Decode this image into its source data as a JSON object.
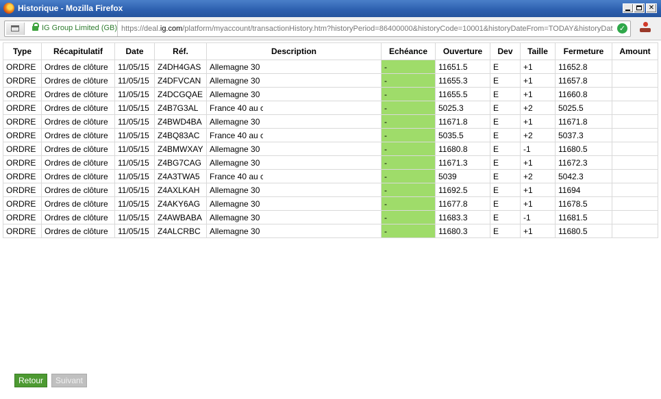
{
  "window": {
    "title": "Historique - Mozilla Firefox",
    "controls": {
      "minimize": "_",
      "maximize": "□",
      "close": "✕"
    }
  },
  "urlbar": {
    "identity": "IG Group Limited (GB)",
    "url_prefix": "https://deal.",
    "url_host": "ig.com",
    "url_rest": "/platform/myaccount/transactionHistory.htm?historyPeriod=86400000&historyCode=10001&historyDateFrom=TODAY&historyDat",
    "check_glyph": "✓"
  },
  "table": {
    "headers": [
      "Type",
      "Récapitulatif",
      "Date",
      "Réf.",
      "Description",
      "Echéance",
      "Ouverture",
      "Dev",
      "Taille",
      "Fermeture",
      "Amount"
    ],
    "rows": [
      {
        "type": "ORDRE",
        "recap": "Ordres de clôture",
        "date": "11/05/15",
        "ref": "Z4DH4GAS",
        "desc": "Allemagne 30",
        "ech": "-",
        "ouv": "11651.5",
        "dev": "E",
        "taille": "+1",
        "ferm": "11652.8"
      },
      {
        "type": "ORDRE",
        "recap": "Ordres de clôture",
        "date": "11/05/15",
        "ref": "Z4DFVCAN",
        "desc": "Allemagne 30",
        "ech": "-",
        "ouv": "11655.3",
        "dev": "E",
        "taille": "+1",
        "ferm": "11657.8"
      },
      {
        "type": "ORDRE",
        "recap": "Ordres de clôture",
        "date": "11/05/15",
        "ref": "Z4DCGQAE",
        "desc": "Allemagne 30",
        "ech": "-",
        "ouv": "11655.5",
        "dev": "E",
        "taille": "+1",
        "ferm": "11660.8"
      },
      {
        "type": "ORDRE",
        "recap": "Ordres de clôture",
        "date": "11/05/15",
        "ref": "Z4B7G3AL",
        "desc": "France 40 au c",
        "ech": "-",
        "ouv": "5025.3",
        "dev": "E",
        "taille": "+2",
        "ferm": "5025.5"
      },
      {
        "type": "ORDRE",
        "recap": "Ordres de clôture",
        "date": "11/05/15",
        "ref": "Z4BWD4BA",
        "desc": "Allemagne 30",
        "ech": "-",
        "ouv": "11671.8",
        "dev": "E",
        "taille": "+1",
        "ferm": "11671.8"
      },
      {
        "type": "ORDRE",
        "recap": "Ordres de clôture",
        "date": "11/05/15",
        "ref": "Z4BQ83AC",
        "desc": "France 40 au c",
        "ech": "-",
        "ouv": "5035.5",
        "dev": "E",
        "taille": "+2",
        "ferm": "5037.3"
      },
      {
        "type": "ORDRE",
        "recap": "Ordres de clôture",
        "date": "11/05/15",
        "ref": "Z4BMWXAY",
        "desc": "Allemagne 30",
        "ech": "-",
        "ouv": "11680.8",
        "dev": "E",
        "taille": "-1",
        "ferm": "11680.5"
      },
      {
        "type": "ORDRE",
        "recap": "Ordres de clôture",
        "date": "11/05/15",
        "ref": "Z4BG7CAG",
        "desc": "Allemagne 30",
        "ech": "-",
        "ouv": "11671.3",
        "dev": "E",
        "taille": "+1",
        "ferm": "11672.3"
      },
      {
        "type": "ORDRE",
        "recap": "Ordres de clôture",
        "date": "11/05/15",
        "ref": "Z4A3TWA5",
        "desc": "France 40 au c",
        "ech": "-",
        "ouv": "5039",
        "dev": "E",
        "taille": "+2",
        "ferm": "5042.3"
      },
      {
        "type": "ORDRE",
        "recap": "Ordres de clôture",
        "date": "11/05/15",
        "ref": "Z4AXLKAH",
        "desc": "Allemagne 30",
        "ech": "-",
        "ouv": "11692.5",
        "dev": "E",
        "taille": "+1",
        "ferm": "11694"
      },
      {
        "type": "ORDRE",
        "recap": "Ordres de clôture",
        "date": "11/05/15",
        "ref": "Z4AKY6AG",
        "desc": "Allemagne 30",
        "ech": "-",
        "ouv": "11677.8",
        "dev": "E",
        "taille": "+1",
        "ferm": "11678.5"
      },
      {
        "type": "ORDRE",
        "recap": "Ordres de clôture",
        "date": "11/05/15",
        "ref": "Z4AWBABA",
        "desc": "Allemagne 30",
        "ech": "-",
        "ouv": "11683.3",
        "dev": "E",
        "taille": "-1",
        "ferm": "11681.5"
      },
      {
        "type": "ORDRE",
        "recap": "Ordres de clôture",
        "date": "11/05/15",
        "ref": "Z4ALCRBC",
        "desc": "Allemagne 30",
        "ech": "-",
        "ouv": "11680.3",
        "dev": "E",
        "taille": "+1",
        "ferm": "11680.5"
      }
    ]
  },
  "buttons": {
    "retour": "Retour",
    "suivant": "Suivant"
  },
  "colors": {
    "echeance_fill": "#9fdc6a",
    "retour_bg": "#4d9a32",
    "suivant_bg": "#c0c0c0",
    "titlebar": "#2c5fae"
  }
}
